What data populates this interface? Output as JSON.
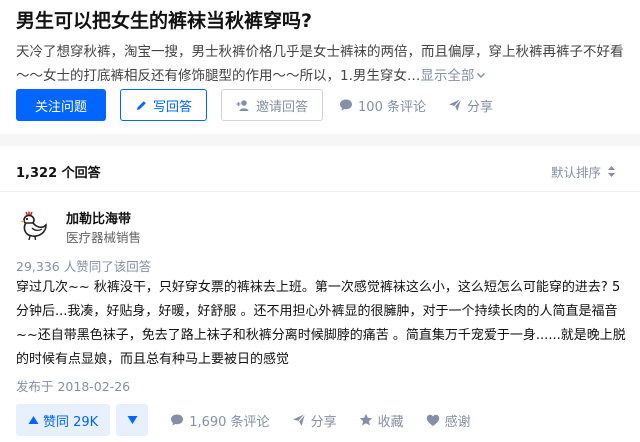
{
  "question": {
    "title": "男生可以把女生的裤袜当秋裤穿吗?",
    "excerpt": "天冷了想穿秋裤，淘宝一搜，男士秋裤价格几乎是女士裤袜的两倍，而且偏厚，穿上秋裤再裤子不好看～～女士的打底裤相反还有修饰腿型的作用～～所以，1.男生穿女…",
    "show_all": "显示全部",
    "follow_label": "关注问题",
    "write_label": "写回答",
    "invite_label": "邀请回答",
    "comments_label": "100 条评论",
    "share_label": "分享"
  },
  "answers": {
    "count_label": "1,322 个回答",
    "sort_label": "默认排序"
  },
  "answer": {
    "author": "加勒比海带",
    "headline": "医疗器械销售",
    "approve_text": "29,336 人赞同了该回答",
    "content": "穿过几次~~ 秋裤没干，只好穿女票的裤袜去上班。第一次感觉裤袜这么小，这么短怎么可能穿的进去? 5分钟后...我凑，好贴身，好暖，好舒服 。还不用担心外裤显的很臃肿，对于一个持续长肉的人简直是福音~~还自带黑色袜子，免去了路上袜子和秋裤分离时候脚脖的痛苦 。简直集万千宠爱于一身......就是晚上脱的时候有点显娘，而且总有种马上要被日的感觉",
    "published": "发布于 2018-02-26",
    "vote_label": "赞同 29K",
    "comments_label": "1,690 条评论",
    "share_label": "分享",
    "collect_label": "收藏",
    "thanks_label": "感谢"
  },
  "colors": {
    "brand": "#0066ff",
    "muted": "#8590a6",
    "vote_bg": "#e8f0fd"
  }
}
